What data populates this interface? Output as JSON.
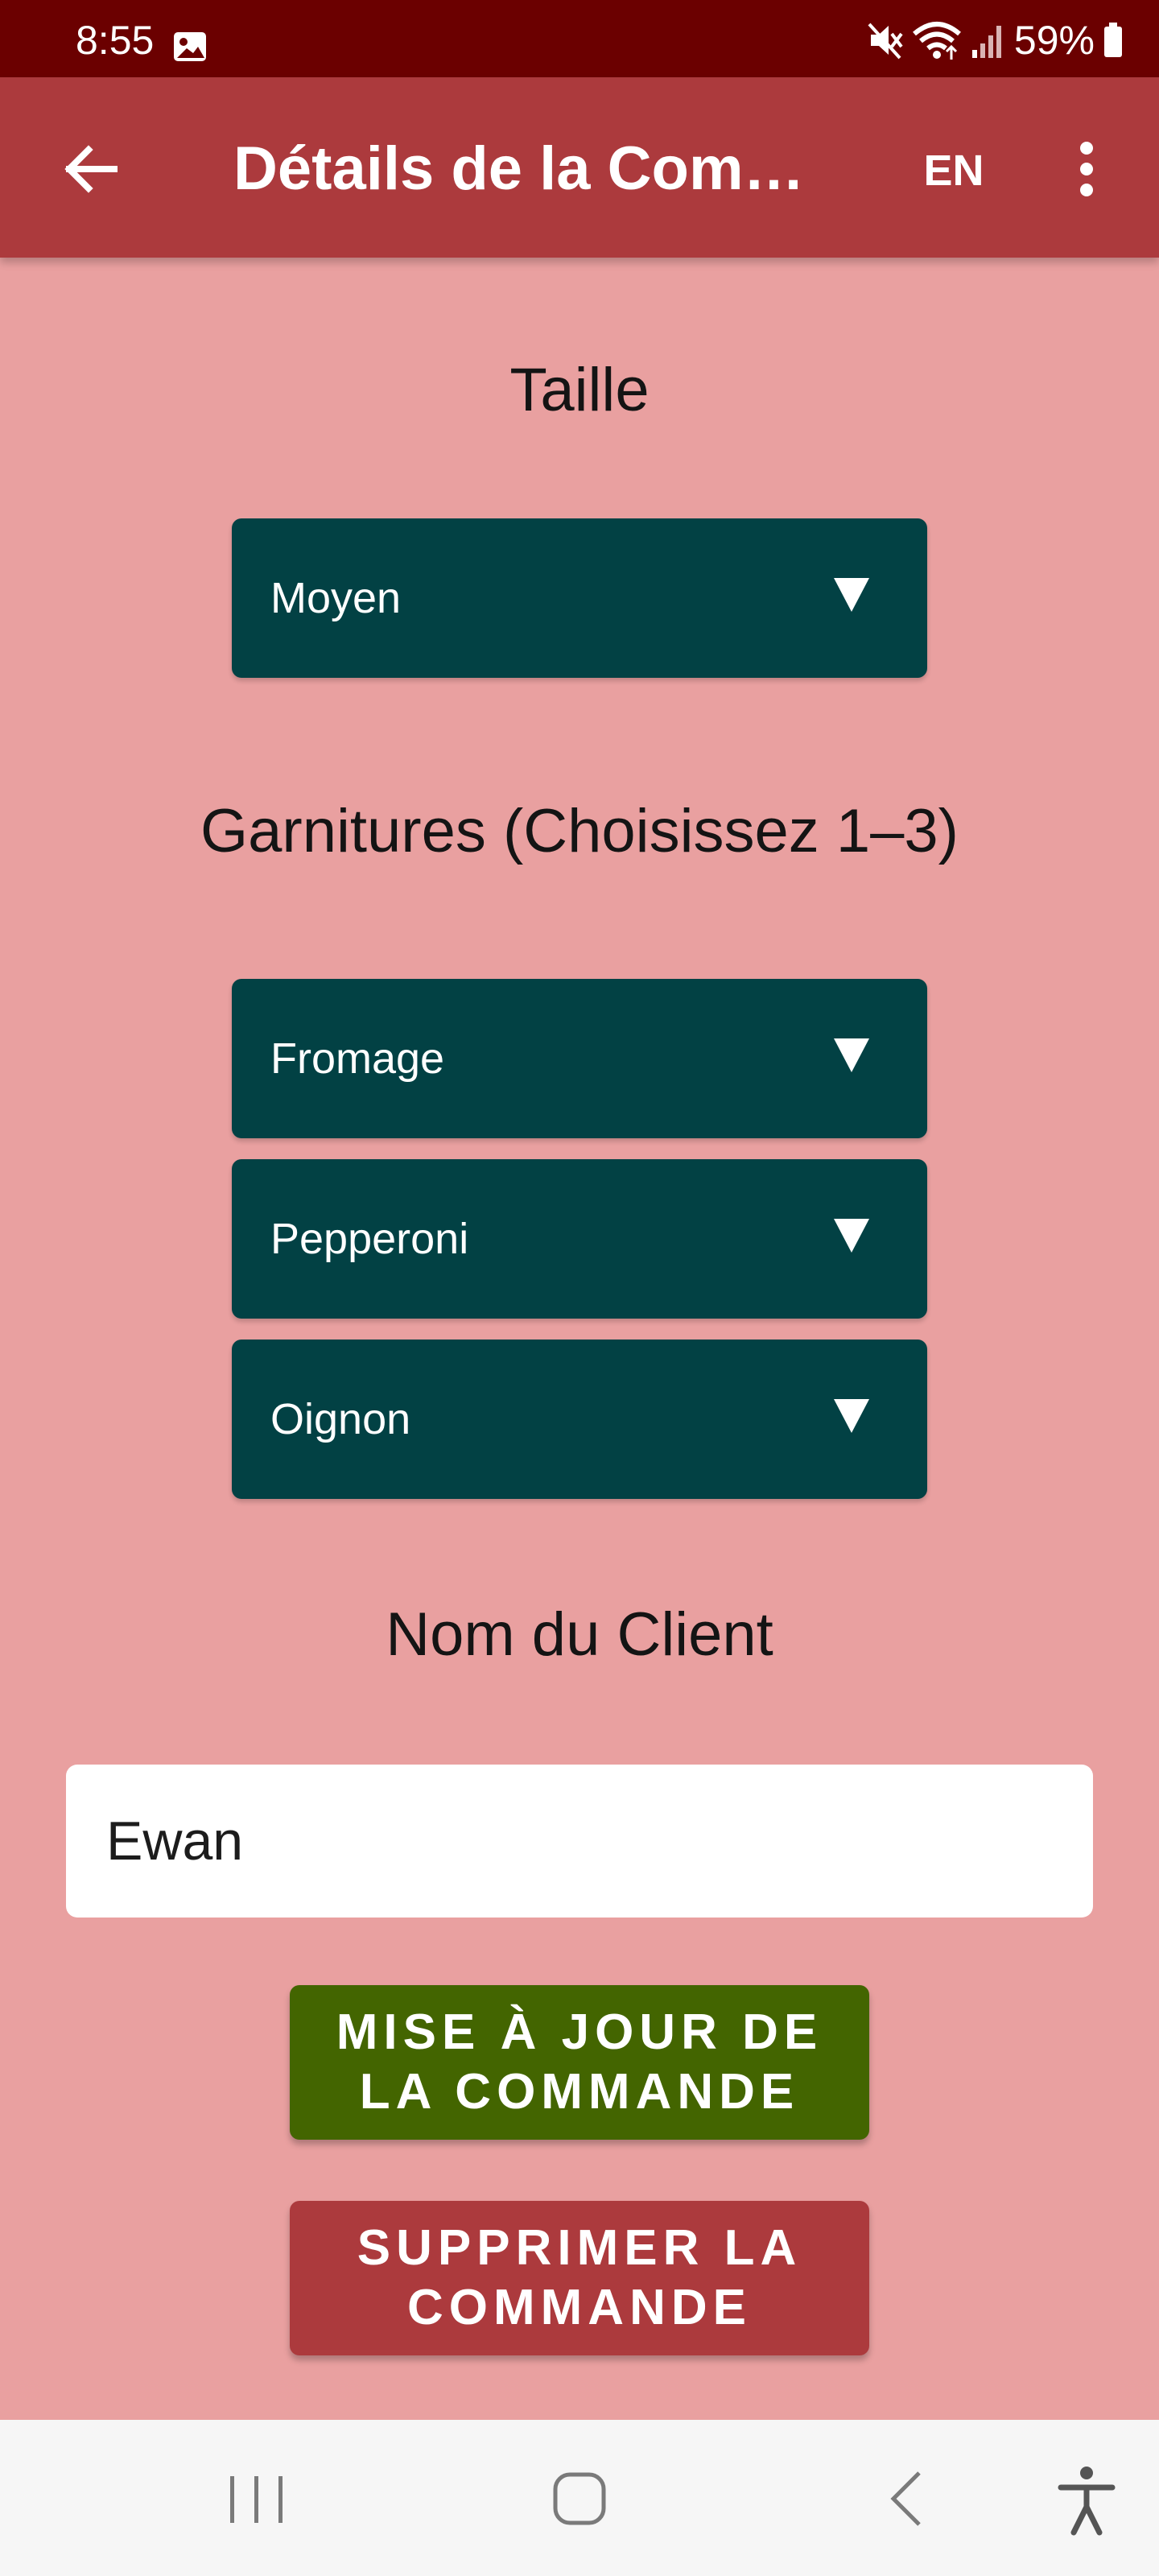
{
  "status_bar": {
    "time": "8:55",
    "battery": "59%",
    "icons": [
      "gallery-icon",
      "mute-icon",
      "wifi-icon",
      "signal-icon",
      "battery-icon"
    ]
  },
  "app_bar": {
    "title": "Détails de la Com…",
    "language_button": "EN",
    "icons": [
      "back-arrow-icon",
      "more-vert-icon"
    ]
  },
  "size": {
    "label": "Taille",
    "selected": "Moyen"
  },
  "toppings": {
    "label": "Garnitures (Choisissez 1–3)",
    "selected": [
      "Fromage",
      "Pepperoni",
      "Oignon"
    ]
  },
  "customer": {
    "label": "Nom du Client",
    "name_value": "Ewan"
  },
  "actions": {
    "update_label": "MISE À JOUR DE LA COMMANDE",
    "delete_label": "SUPPRIMER LA COMMANDE"
  },
  "nav_bar": {
    "icons": [
      "recent-apps-icon",
      "home-icon",
      "back-icon",
      "accessibility-icon"
    ]
  },
  "colors": {
    "status_bar": "#6b0000",
    "app_bar": "#ac3a3d",
    "background": "#e9a0a0",
    "dropdown": "#024144",
    "update_button": "#436500",
    "delete_button": "#ac3a3d"
  }
}
